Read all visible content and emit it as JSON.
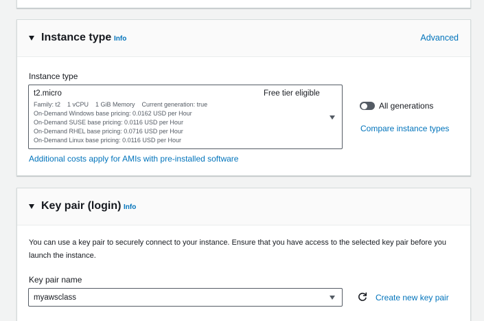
{
  "instance_type_section": {
    "title": "Instance type",
    "info": "Info",
    "advanced": "Advanced",
    "field_label": "Instance type",
    "selected": {
      "name": "t2.micro",
      "free_tier": "Free tier eligible",
      "details": [
        "Family: t2    1 vCPU    1 GiB Memory    Current generation: true",
        "On-Demand Windows base pricing: 0.0162 USD per Hour",
        "On-Demand SUSE base pricing: 0.0116 USD per Hour",
        "On-Demand RHEL base pricing: 0.0716 USD per Hour",
        "On-Demand Linux base pricing: 0.0116 USD per Hour"
      ]
    },
    "all_generations_label": "All generations",
    "all_generations_enabled": false,
    "compare_link": "Compare instance types",
    "additional_costs_link": "Additional costs apply for AMIs with pre-installed software"
  },
  "key_pair_section": {
    "title": "Key pair (login)",
    "info": "Info",
    "description": "You can use a key pair to securely connect to your instance. Ensure that you have access to the selected key pair before you launch the instance.",
    "field_label": "Key pair name",
    "selected_value": "myawsclass",
    "create_link": "Create new key pair"
  },
  "icons": {
    "collapse": "caret-down-icon",
    "dropdown": "triangle-down-icon",
    "refresh": "refresh-icon"
  },
  "colors": {
    "link": "#0073bb",
    "text": "#16191f",
    "secondary_text": "#545b64",
    "page_background": "#f2f3f3",
    "border": "#d5dbdb"
  }
}
